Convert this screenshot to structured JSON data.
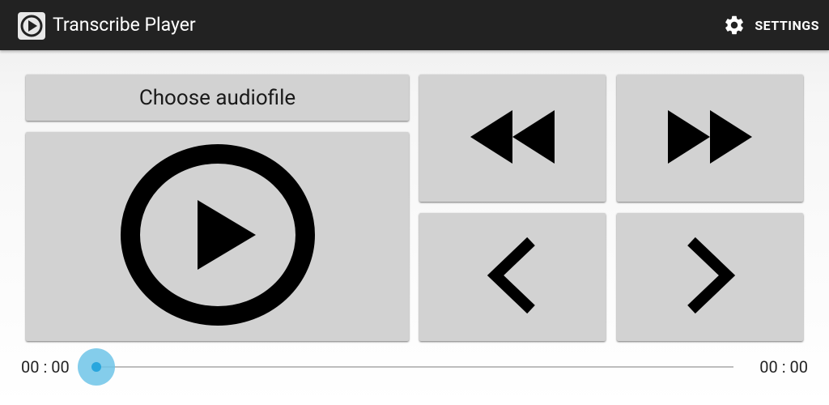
{
  "actionbar": {
    "title": "Transcribe Player",
    "app_icon": "play-circle-icon",
    "settings_icon": "gear-icon",
    "settings_label": "SETTINGS"
  },
  "controls": {
    "choose_label": "Choose audiofile",
    "play_icon": "play-circle-icon",
    "rewind_icon": "rewind-icon",
    "fast_forward_icon": "fast-forward-icon",
    "step_back_icon": "chevron-left-icon",
    "step_forward_icon": "chevron-right-icon"
  },
  "seek": {
    "current_time": "00 : 00",
    "total_time": "00 : 00",
    "progress": 0,
    "accent_color": "#29a6dd"
  },
  "colors": {
    "actionbar": "#222222",
    "button": "#d2d2d2"
  }
}
